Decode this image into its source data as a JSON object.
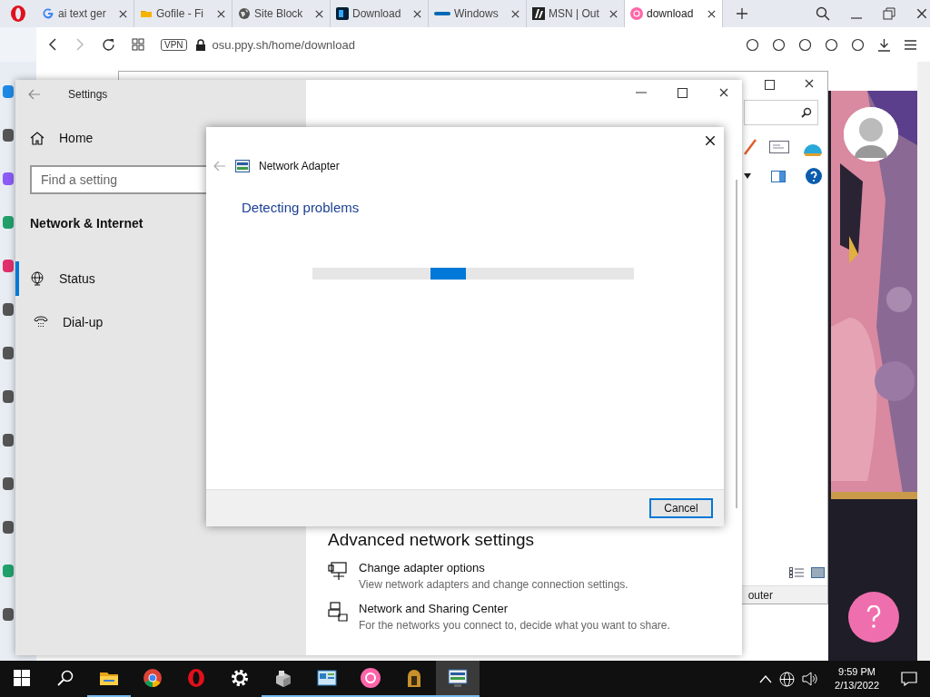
{
  "browser": {
    "tabs": [
      {
        "label": "ai text ger",
        "kind": "google",
        "selected": false
      },
      {
        "label": "Gofile - Fi",
        "kind": "folder",
        "selected": false
      },
      {
        "label": "Site Block",
        "kind": "globe",
        "selected": false
      },
      {
        "label": "Download",
        "kind": "ps",
        "selected": false
      },
      {
        "label": "Windows",
        "kind": "intel",
        "selected": false
      },
      {
        "label": "MSN | Out",
        "kind": "msn",
        "selected": false
      },
      {
        "label": "download",
        "kind": "osu",
        "selected": true
      }
    ],
    "vpn": "VPN",
    "address": "osu.ppy.sh/home/download"
  },
  "network_connections": {
    "status_text": "outer"
  },
  "settings": {
    "title": "Settings",
    "home": "Home",
    "search": {
      "placeholder": "Find a setting"
    },
    "section": "Network & Internet",
    "nav": [
      {
        "label": "Status",
        "kind": "status",
        "selected": true
      },
      {
        "label": "Dial-up",
        "kind": "dialup",
        "selected": false
      }
    ],
    "heading": "Advanced network settings",
    "links": [
      {
        "title": "Change adapter options",
        "description": "View network adapters and change connection settings.",
        "kind": "adapter"
      },
      {
        "title": "Network and Sharing Center",
        "description": "For the networks you connect to, decide what you want to share.",
        "kind": "sharing"
      }
    ]
  },
  "dialog": {
    "title": "Network Adapter",
    "heading": "Detecting problems",
    "button": "Cancel"
  },
  "taskbar": {
    "apps": [
      {
        "kind": "explorer",
        "running": true,
        "selected": false
      },
      {
        "kind": "chrome",
        "running": false,
        "selected": false
      },
      {
        "kind": "opera",
        "running": false,
        "selected": false
      },
      {
        "kind": "gear",
        "running": false,
        "selected": false
      },
      {
        "kind": "device",
        "running": true,
        "selected": false
      },
      {
        "kind": "panel",
        "running": true,
        "selected": false
      },
      {
        "kind": "osu",
        "running": true,
        "selected": false
      },
      {
        "kind": "helmet",
        "running": true,
        "selected": false
      },
      {
        "kind": "network",
        "running": true,
        "selected": true
      }
    ],
    "time": "9:59 PM",
    "date": "2/13/2022"
  }
}
